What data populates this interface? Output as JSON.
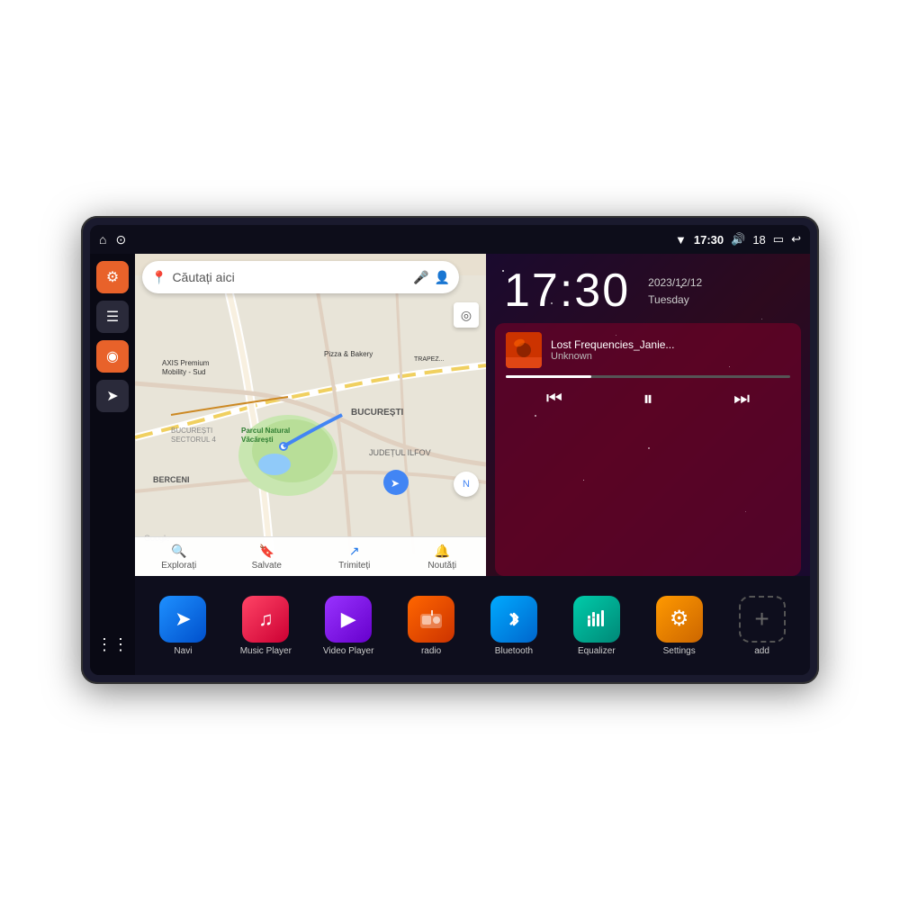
{
  "device": {
    "status_bar": {
      "wifi_icon": "▼",
      "time": "17:30",
      "volume_icon": "🔊",
      "battery_level": "18",
      "battery_icon": "🔋",
      "back_icon": "↩",
      "home_icon": "⌂",
      "maps_icon": "⊙"
    },
    "clock": {
      "time": "17:30",
      "date_line1": "2023/12/12",
      "date_line2": "Tuesday"
    },
    "music": {
      "track_name": "Lost Frequencies_Janie...",
      "artist": "Unknown",
      "progress_percent": 30
    },
    "map": {
      "search_placeholder": "Căutați aici",
      "labels": [
        "AXIS Premium Mobility - Sud",
        "Pizza & Bakery",
        "TRAPEZULUI",
        "Parcul Natural Văcărești",
        "BUCUREȘTI",
        "BERCENI",
        "BUCUREȘTI SECTORUL 4",
        "JUDEȚUL ILFOV"
      ],
      "bottom_tabs": [
        {
          "label": "Explorați",
          "icon": "◉"
        },
        {
          "label": "Salvate",
          "icon": "🔖"
        },
        {
          "label": "Trimiteți",
          "icon": "↗"
        },
        {
          "label": "Noutăți",
          "icon": "🔔"
        }
      ]
    },
    "sidebar": {
      "items": [
        {
          "icon": "⚙",
          "color": "orange",
          "label": "settings"
        },
        {
          "icon": "☰",
          "color": "dark",
          "label": "menu"
        },
        {
          "icon": "◉",
          "color": "orange",
          "label": "maps"
        },
        {
          "icon": "➤",
          "color": "dark",
          "label": "nav"
        },
        {
          "icon": "⋮⋮⋮",
          "color": "grid",
          "label": "apps"
        }
      ]
    },
    "app_launcher": {
      "apps": [
        {
          "label": "Navi",
          "icon": "➤",
          "color": "blue-grad"
        },
        {
          "label": "Music Player",
          "icon": "♫",
          "color": "red-grad"
        },
        {
          "label": "Video Player",
          "icon": "▶",
          "color": "purple-grad"
        },
        {
          "label": "radio",
          "icon": "📻",
          "color": "orange-grad"
        },
        {
          "label": "Bluetooth",
          "icon": "⚡",
          "color": "blue2-grad"
        },
        {
          "label": "Equalizer",
          "icon": "⏸",
          "color": "teal-grad"
        },
        {
          "label": "Settings",
          "icon": "⚙",
          "color": "orange2-grad"
        },
        {
          "label": "add",
          "icon": "+",
          "color": "add-icon"
        }
      ]
    }
  }
}
